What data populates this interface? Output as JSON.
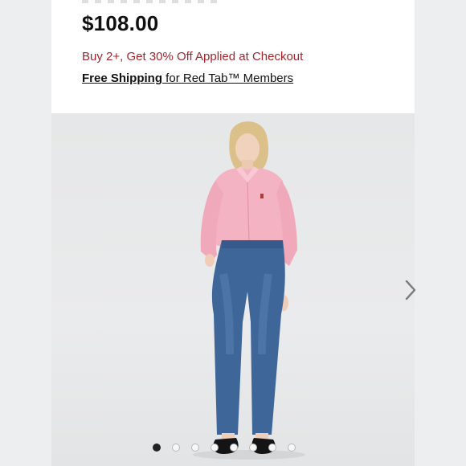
{
  "product": {
    "price": "$108.00",
    "promo": "Buy 2+, Get 30% Off Applied at Checkout",
    "shipping_strong": "Free Shipping",
    "shipping_rest": " for Red Tab™ Members"
  },
  "gallery": {
    "image_count": 8,
    "active_index": 0,
    "next_icon": "chevron-right-icon"
  },
  "colors": {
    "promo": "#a5242c",
    "price": "#111111",
    "active_dot": "#222222"
  }
}
